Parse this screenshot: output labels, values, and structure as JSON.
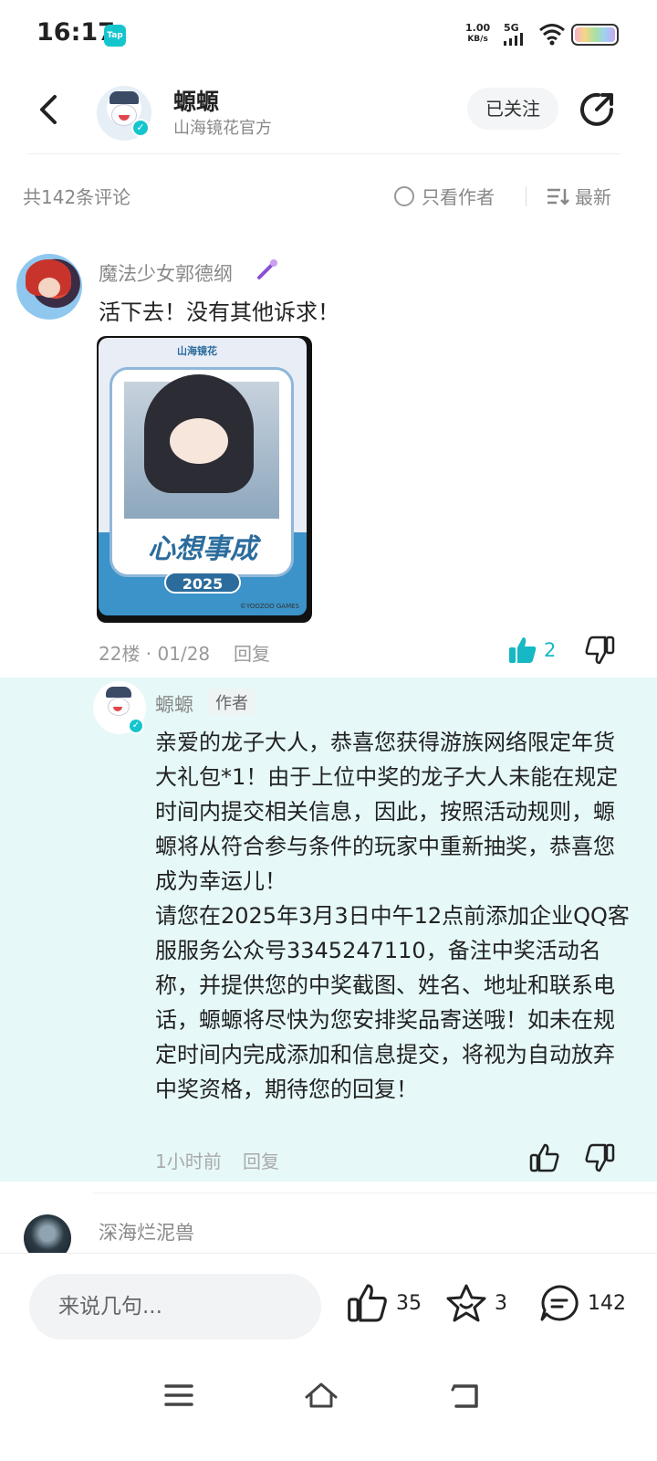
{
  "status": {
    "time": "16:17",
    "app_badge": "Tap",
    "net_speed_value": "1.00",
    "net_speed_unit": "KB/s",
    "network": "5G"
  },
  "header": {
    "name": "螈螈",
    "subtitle": "山海镜花官方",
    "follow_label": "已关注"
  },
  "filter": {
    "count": "共142条评论",
    "only_author": "只看作者",
    "sort": "最新"
  },
  "comment": {
    "author": "魔法少女郭德纲",
    "text": "活下去！没有其他诉求！",
    "image": {
      "logo": "山海镜花",
      "title": "心想事成",
      "year": "2025",
      "copyright": "©YOOZOO GAMES"
    },
    "meta": "22楼 · 01/28",
    "reply_label": "回复",
    "likes": "2"
  },
  "reply": {
    "author": "螈螈",
    "tag": "作者",
    "text": "亲爱的龙子大人，恭喜您获得游族网络限定年货大礼包*1！由于上位中奖的龙子大人未能在规定时间内提交相关信息，因此，按照活动规则，螈螈将从符合参与条件的玩家中重新抽奖，恭喜您成为幸运儿！\n请您在2025年3月3日中午12点前添加企业QQ客服服务公众号3345247110，备注中奖活动名称，并提供您的中奖截图、姓名、地址和联系电话，螈螈将尽快为您安排奖品寄送哦！如未在规定时间内完成添加和信息提交，将视为自动放弃中奖资格，期待您的回复！",
    "time": "1小时前",
    "reply_label": "回复"
  },
  "next_comment": {
    "author": "深海烂泥兽"
  },
  "bottom": {
    "placeholder": "来说几句...",
    "likes": "35",
    "favorites": "3",
    "comments": "142"
  },
  "colors": {
    "accent": "#15c5ce",
    "reply_bg": "#e6f8f8"
  }
}
